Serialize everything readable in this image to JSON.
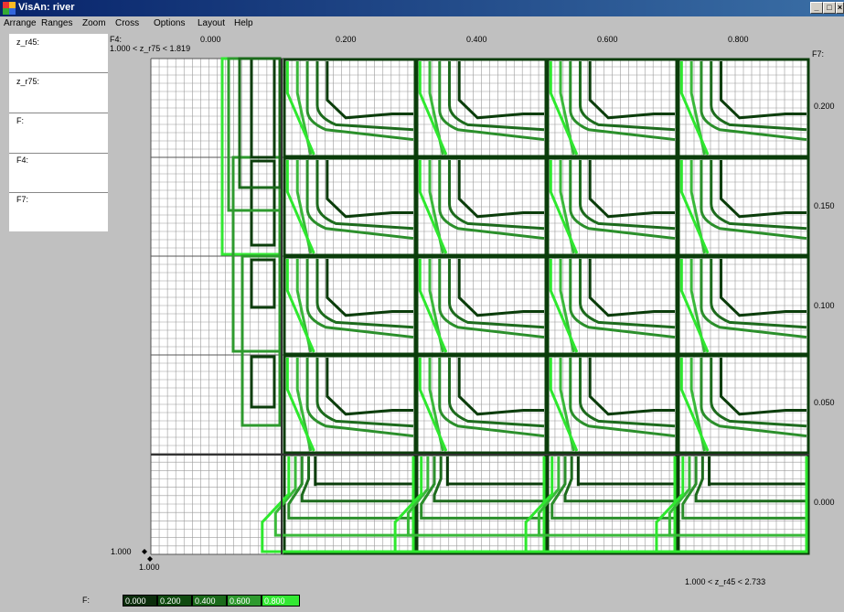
{
  "window": {
    "title": "VisAn: river",
    "min": "_",
    "max": "□",
    "close": "×"
  },
  "menu": [
    "Arrange",
    "Ranges",
    "Zoom",
    "Cross",
    "Options",
    "Layout",
    "Help"
  ],
  "side_panel": [
    "z_r45:",
    "z_r75:",
    "F:",
    "F4:",
    "F7:"
  ],
  "plot": {
    "f4_label": "F4:",
    "f4_first": "0.000",
    "range_top": "1.000 < z_r75 < 1.819",
    "f7_label": "F7:",
    "col_labels": [
      "0.200",
      "0.400",
      "0.600",
      "0.800"
    ],
    "row_labels": [
      "0.200",
      "0.150",
      "0.100",
      "0.050",
      "0.000"
    ],
    "y_origin": "1.000",
    "x_origin": "1.000",
    "range_bottom": "1.000 < z_r45 < 2.733"
  },
  "legend": {
    "label": "F:",
    "items": [
      {
        "text": "0.000",
        "color": "#0b2d0b"
      },
      {
        "text": "0.200",
        "color": "#0f4a0f"
      },
      {
        "text": "0.400",
        "color": "#1a6a1a"
      },
      {
        "text": "0.600",
        "color": "#2e9a2e"
      },
      {
        "text": "0.800",
        "color": "#33e833"
      }
    ]
  },
  "colors": {
    "title_bar": "#08246b",
    "background": "#c0c0c0",
    "grid": "#a8a8a8",
    "contours": [
      "#0b3d0b",
      "#1d6b1d",
      "#2b8f2b",
      "#3ab83a",
      "#2ee82e"
    ]
  }
}
